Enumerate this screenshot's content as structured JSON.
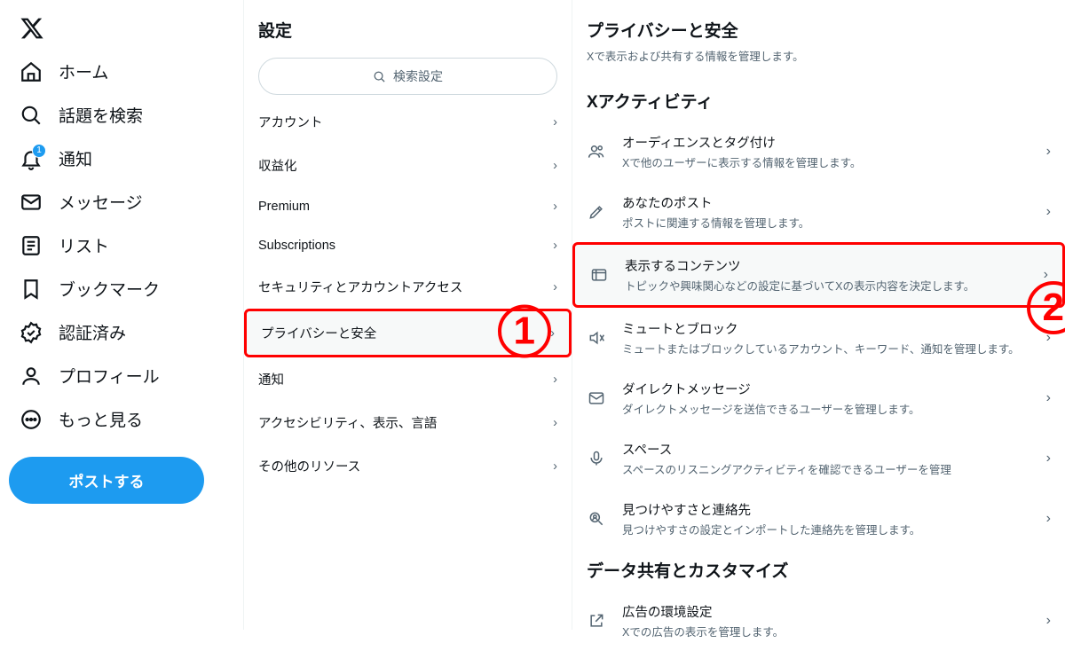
{
  "nav": {
    "home": "ホーム",
    "explore": "話題を検索",
    "notifications": "通知",
    "notifications_badge": "1",
    "messages": "メッセージ",
    "lists": "リスト",
    "bookmarks": "ブックマーク",
    "verified": "認証済み",
    "profile": "プロフィール",
    "more": "もっと見る",
    "post_button": "ポストする"
  },
  "settings": {
    "title": "設定",
    "search_placeholder": "検索設定",
    "items": {
      "account": "アカウント",
      "monetization": "収益化",
      "premium": "Premium",
      "subscriptions": "Subscriptions",
      "security": "セキュリティとアカウントアクセス",
      "privacy": "プライバシーと安全",
      "notifications": "通知",
      "accessibility": "アクセシビリティ、表示、言語",
      "resources": "その他のリソース"
    }
  },
  "detail": {
    "title": "プライバシーと安全",
    "subtitle": "Xで表示および共有する情報を管理します。",
    "section_activity": "Xアクティビティ",
    "audience": {
      "title": "オーディエンスとタグ付け",
      "desc": "Xで他のユーザーに表示する情報を管理します。"
    },
    "posts": {
      "title": "あなたのポスト",
      "desc": "ポストに関連する情報を管理します。"
    },
    "content": {
      "title": "表示するコンテンツ",
      "desc": "トピックや興味関心などの設定に基づいてXの表示内容を決定します。"
    },
    "mute": {
      "title": "ミュートとブロック",
      "desc": "ミュートまたはブロックしているアカウント、キーワード、通知を管理します。"
    },
    "dm": {
      "title": "ダイレクトメッセージ",
      "desc": "ダイレクトメッセージを送信できるユーザーを管理します。"
    },
    "spaces": {
      "title": "スペース",
      "desc": "スペースのリスニングアクティビティを確認できるユーザーを管理"
    },
    "discover": {
      "title": "見つけやすさと連絡先",
      "desc": "見つけやすさの設定とインポートした連絡先を管理します。"
    },
    "section_data": "データ共有とカスタマイズ",
    "ads": {
      "title": "広告の環境設定",
      "desc": "Xでの広告の表示を管理します。"
    }
  },
  "annotations": {
    "n1": "1",
    "n2": "2"
  }
}
